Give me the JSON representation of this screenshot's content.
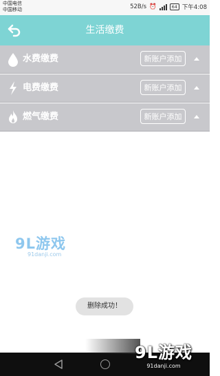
{
  "status_bar": {
    "carrier_1": "中国电信",
    "carrier_2": "中国移动",
    "net_speed": "52B/s",
    "battery": "64",
    "time": "下午4:08"
  },
  "header": {
    "title": "生活缴费",
    "back_icon": "back-arrow-icon"
  },
  "rows": [
    {
      "label": "水费缴费",
      "button": "新账户添加",
      "icon": "water-drop-icon"
    },
    {
      "label": "电费缴费",
      "button": "新账户添加",
      "icon": "lightning-icon"
    },
    {
      "label": "燃气缴费",
      "button": "新账户添加",
      "icon": "flame-icon"
    }
  ],
  "toast": "删除成功！",
  "watermark": {
    "logo": "9L游戏",
    "url": "91danji.com"
  },
  "colors": {
    "header": "#7ed4d4",
    "row_bg": "#c8c8cc",
    "nav_bar": "#0f0f0f"
  }
}
